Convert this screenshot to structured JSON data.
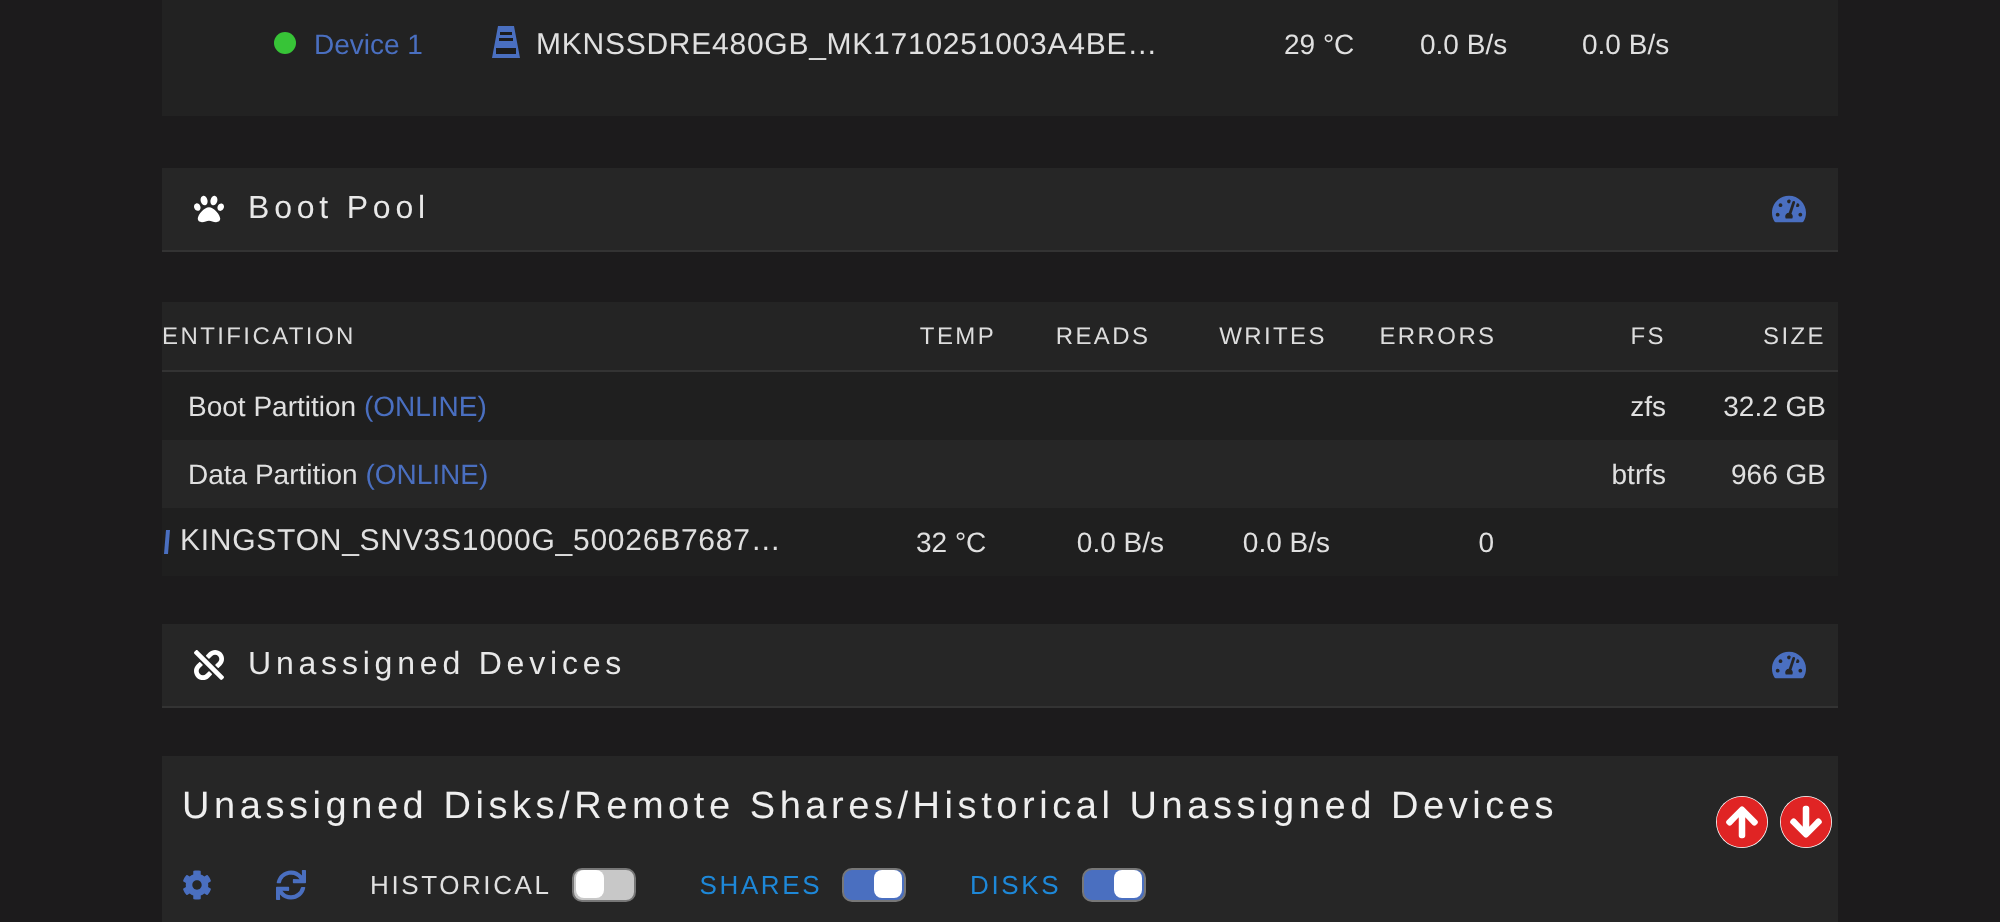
{
  "top_device": {
    "color": "#37c437",
    "name": "Device 1",
    "identification": "MKNSSDRE480GB_MK1710251003A4BE…",
    "temp": "29 °C",
    "reads": "0.0 B/s",
    "writes": "0.0 B/s"
  },
  "boot_pool": {
    "title": "Boot Pool",
    "columns": [
      "ENTIFICATION",
      "TEMP",
      "READS",
      "WRITES",
      "ERRORS",
      "FS",
      "SIZE"
    ],
    "rows": [
      {
        "kind": "partition",
        "name": "Boot Partition",
        "status": "(ONLINE)",
        "fs": "zfs",
        "size": "32.2 GB"
      },
      {
        "kind": "partition",
        "name": "Data Partition",
        "status": "(ONLINE)",
        "fs": "btrfs",
        "size": "966 GB"
      },
      {
        "kind": "disk",
        "identification": "KINGSTON_SNV3S1000G_50026B7687…",
        "temp": "32 °C",
        "reads": "0.0 B/s",
        "writes": "0.0 B/s",
        "errors": "0"
      }
    ]
  },
  "unassigned": {
    "title": "Unassigned Devices",
    "panel_title": "Unassigned Disks/Remote Shares/Historical Unassigned Devices",
    "toggles": [
      {
        "label": "HISTORICAL",
        "on": false
      },
      {
        "label": "SHARES",
        "on": true
      },
      {
        "label": "DISKS",
        "on": true
      }
    ]
  }
}
